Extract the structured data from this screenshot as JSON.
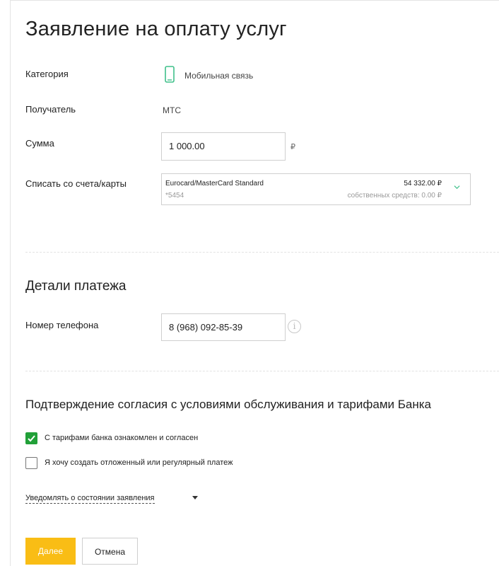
{
  "title": "Заявление на оплату услуг",
  "category": {
    "label": "Категория",
    "value": "Мобильная связь",
    "icon": "mobile-phone-icon"
  },
  "recipient": {
    "label": "Получатель",
    "value": "МТС"
  },
  "amount": {
    "label": "Сумма",
    "value": "1 000.00",
    "currency": "₽"
  },
  "account": {
    "label": "Списать со счета/карты",
    "card_name": "Eurocard/MasterCard Standard",
    "card_number": "*5454",
    "balance": "54 332.00 ₽",
    "own_funds": "собственных средств: 0.00 ₽"
  },
  "details": {
    "heading": "Детали платежа",
    "phone_label": "Номер телефона",
    "phone_value": "8 (968) 092-85-39",
    "info_icon": "info-icon"
  },
  "consent": {
    "heading": "Подтверждение согласия с условиями обслуживания и тарифами Банка",
    "agree_label": "С тарифами банка ознакомлен и согласен",
    "agree_checked": true,
    "scheduled_label": "Я хочу создать отложенный или регулярный платеж",
    "scheduled_checked": false
  },
  "notify": {
    "label": "Уведомлять о состоянии заявления"
  },
  "buttons": {
    "next": "Далее",
    "cancel": "Отмена"
  },
  "colors": {
    "accent_green": "#21a038",
    "primary_button": "#f9bd15"
  }
}
